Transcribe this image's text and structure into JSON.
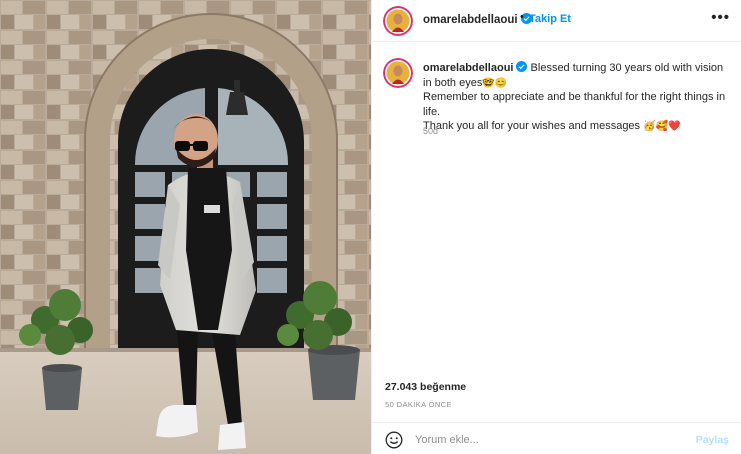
{
  "post": {
    "username": "omarelabdellaoui",
    "separator": "•",
    "follow_label": "Takip Et",
    "more_label": "•••",
    "caption_line1": " Blessed turning 30 years old with vision in both eyes",
    "caption_line2": "Remember to appreciate and be thankful for the right things in life.",
    "caption_line3": "Thank you all for your wishes and messages ",
    "caption_emoji1": "🤓",
    "caption_emoji2": "😊",
    "caption_emoji3": "🥳",
    "caption_emoji4": "🥰",
    "caption_emoji5": "❤️",
    "caption_age": "50d",
    "likes": "27.043 beğenme",
    "posted_ago": "50 DAKİKA ÖNCE"
  },
  "comment": {
    "placeholder": "Yorum ekle...",
    "share_label": "Paylaş"
  },
  "icons": {
    "verified": "verified-badge-icon",
    "emoji": "smiley-face-icon",
    "more": "more-options-icon"
  },
  "colors": {
    "accent": "#0095f6",
    "share_disabled": "#b2dffc",
    "muted": "#8e8e8e",
    "avatar_ring": "#e1306c"
  }
}
